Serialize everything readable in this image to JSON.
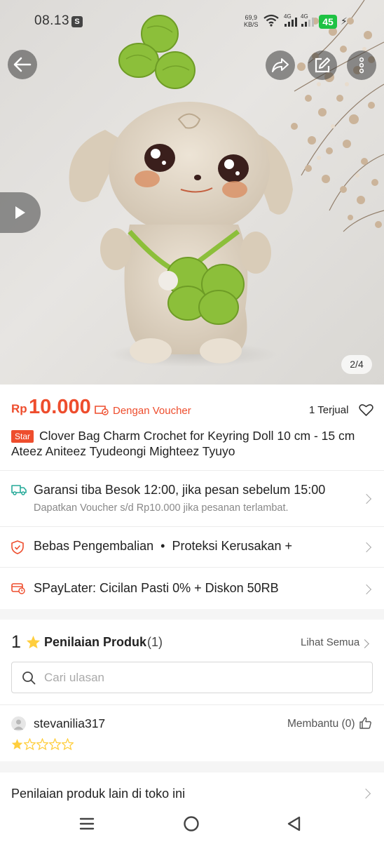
{
  "status_bar": {
    "time": "08.13",
    "speed_value": "69,9",
    "speed_unit": "KB/S",
    "network_1": "4G",
    "network_2": "4G",
    "battery": "45"
  },
  "gallery": {
    "page_indicator": "2/4"
  },
  "price": {
    "currency": "Rp",
    "amount": "10.000",
    "voucher_label": "Dengan Voucher",
    "sold": "1 Terjual"
  },
  "product": {
    "badge": "Star",
    "title": "Clover Bag Charm Crochet for Keyring Doll 10 cm - 15 cm Ateez Aniteez Tyudeongi Mighteez Tyuyo"
  },
  "delivery": {
    "title": "Garansi tiba Besok 12:00, jika pesan sebelum 15:00",
    "subtitle": "Dapatkan Voucher s/d Rp10.000 jika pesanan terlambat."
  },
  "protection": {
    "label_1": "Bebas Pengembalian",
    "separator": "•",
    "label_2": "Proteksi Kerusakan +"
  },
  "paylater": {
    "label": "SPayLater: Cicilan Pasti 0% + Diskon 50RB"
  },
  "reviews": {
    "rating": "1",
    "title": "Penilaian Produk",
    "count": "(1)",
    "see_all": "Lihat Semua",
    "search_placeholder": "Cari ulasan",
    "items": [
      {
        "username": "stevanilia317",
        "helpful": "Membantu (0)",
        "stars": 1,
        "max_stars": 5
      }
    ]
  },
  "other_reviews": {
    "label": "Penilaian produk lain di toko ini"
  },
  "colors": {
    "accent": "#ee4d2d",
    "star": "#ffce3d",
    "battery": "#1ec243",
    "delivery_icon": "#26aa99"
  }
}
